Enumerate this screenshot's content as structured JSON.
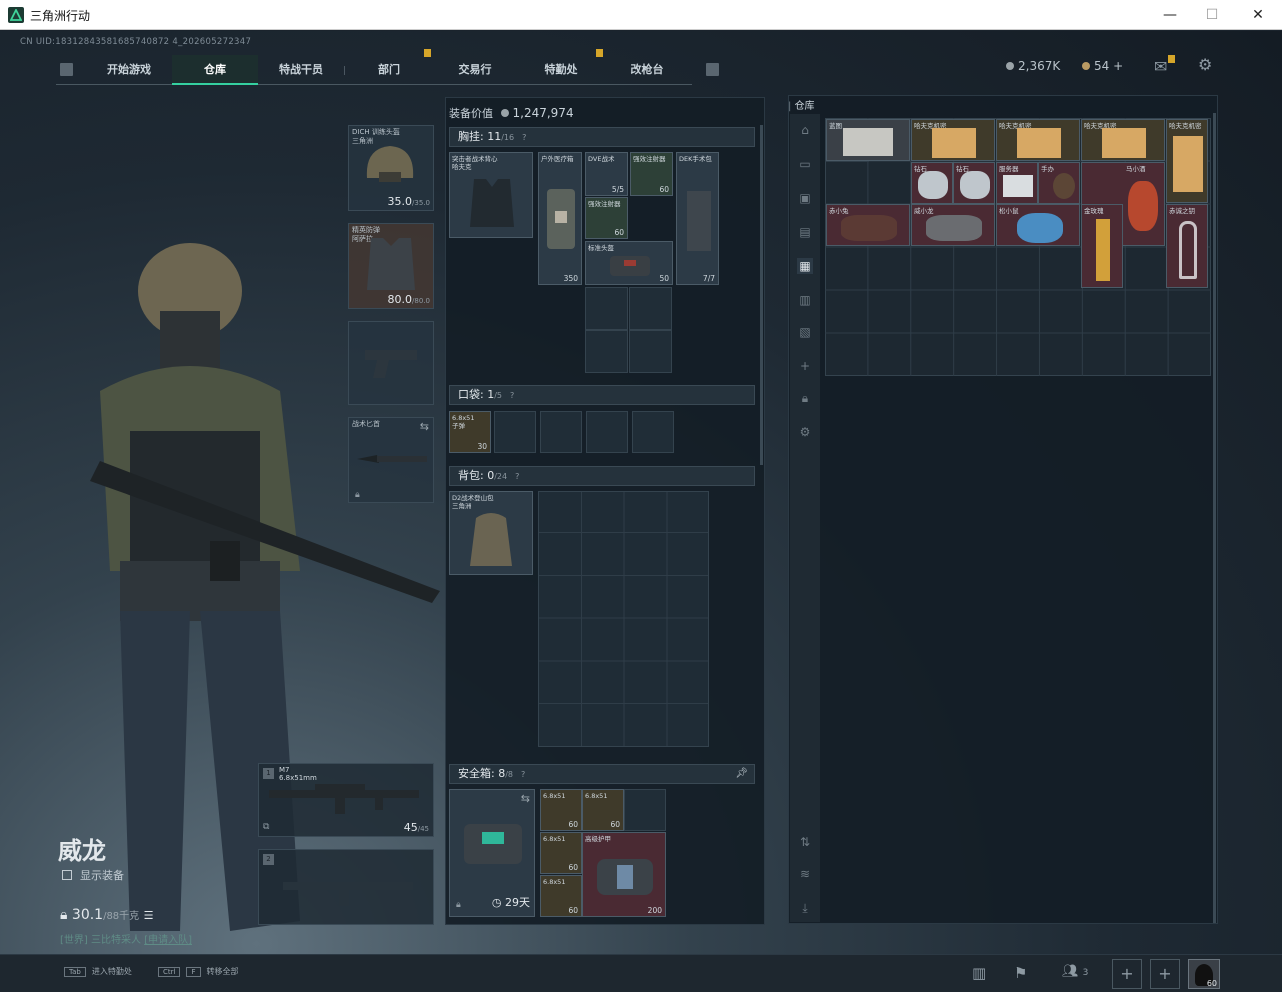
{
  "window": {
    "title": "三角洲行动"
  },
  "uid": "CN UID:18312843581685740872 4_202605272347",
  "nav": {
    "tabs": [
      "开始游戏",
      "仓库",
      "特战干员",
      "部门",
      "交易行",
      "特勤处",
      "改枪台"
    ],
    "active": "仓库"
  },
  "currency": {
    "coins": "2,367K",
    "tickets": "54"
  },
  "operator": {
    "name": "威龙",
    "show_equipment": "显示装备",
    "weight_value": "30.1",
    "weight_max": "/88千克",
    "chat_world": "[世界]",
    "chat_name": "三比特采人",
    "chat_apply": "[申请入队]"
  },
  "equipment": {
    "helmet": {
      "label": "DICH 训练头盔\n三角洲",
      "durability": "35.0",
      "max": "/35.0"
    },
    "armor": {
      "label": "精英防弹\n阿萨拉",
      "durability": "80.0",
      "max": "/80.0"
    },
    "melee": {
      "label": "战术匕首"
    },
    "primary": {
      "slot": "1",
      "name": "M7",
      "caliber": "6.8x51mm",
      "ammo": "45",
      "ammo_max": "/45"
    },
    "secondary": {
      "slot": "2"
    }
  },
  "loadout": {
    "value_label": "装备价值",
    "value": "1,247,974",
    "chest": {
      "title": "胸挂:",
      "count": "11",
      "max": "/16"
    },
    "chest_items": [
      {
        "name": "突击者战术背心\n哈夫克",
        "count": ""
      },
      {
        "name": "户外医疗箱",
        "count": "350"
      },
      {
        "name": "DVE战术",
        "count": "5/5"
      },
      {
        "name": "强效注射器",
        "count": "60"
      },
      {
        "name": "强效注射器",
        "count": "60"
      },
      {
        "name": "DEK手术包",
        "count": "7/7"
      },
      {
        "name": "标准头盔",
        "count": "50"
      }
    ],
    "pocket": {
      "title": "口袋:",
      "count": "1",
      "max": "/5"
    },
    "pocket_items": [
      {
        "name": "6.8x51\n子弹",
        "count": "30"
      }
    ],
    "backpack": {
      "title": "背包:",
      "count": "0",
      "max": "/24"
    },
    "backpack_item": {
      "name": "D2战术登山包\n三角洲"
    },
    "safebox": {
      "title": "安全箱:",
      "count": "8",
      "max": "/8"
    },
    "safebox_time": "29天",
    "safebox_items": [
      {
        "name": "6.8x51",
        "count": "60"
      },
      {
        "name": "6.8x51",
        "count": "60"
      },
      {
        "name": "6.8x51",
        "count": "60"
      },
      {
        "name": "6.8x51",
        "count": "60"
      },
      {
        "name": "高级护甲",
        "count": "200"
      }
    ]
  },
  "stash": {
    "title": "仓库",
    "items": [
      {
        "name": "蓝图",
        "tone": "grey"
      },
      {
        "name": "哈夫克机密",
        "tone": "gold"
      },
      {
        "name": "哈夫克机密",
        "tone": "gold"
      },
      {
        "name": "哈夫克机密",
        "tone": "gold"
      },
      {
        "name": "哈夫克机密",
        "tone": "gold"
      },
      {
        "name": "钻石",
        "tone": "red"
      },
      {
        "name": "钻石",
        "tone": "red"
      },
      {
        "name": "服务器",
        "tone": "red"
      },
      {
        "name": "手办",
        "tone": "red"
      },
      {
        "name": "马小酒",
        "tone": "red"
      },
      {
        "name": "赤小兔",
        "tone": "red"
      },
      {
        "name": "威小龙",
        "tone": "red"
      },
      {
        "name": "松小鼠",
        "tone": "red"
      },
      {
        "name": "金玫瑰",
        "tone": "red"
      },
      {
        "name": "赤诚之钥",
        "tone": "red"
      }
    ]
  },
  "bottom": {
    "key1": "Tab",
    "action1": "进入特勤处",
    "key2": "Ctrl",
    "key3": "F",
    "action2": "转移全部",
    "friends": "3",
    "level": "60"
  },
  "colors": {
    "accent": "#35d0a0",
    "alert": "#d6a62a",
    "rare_red": "#4a2a33",
    "gold": "#3f3a2a"
  }
}
